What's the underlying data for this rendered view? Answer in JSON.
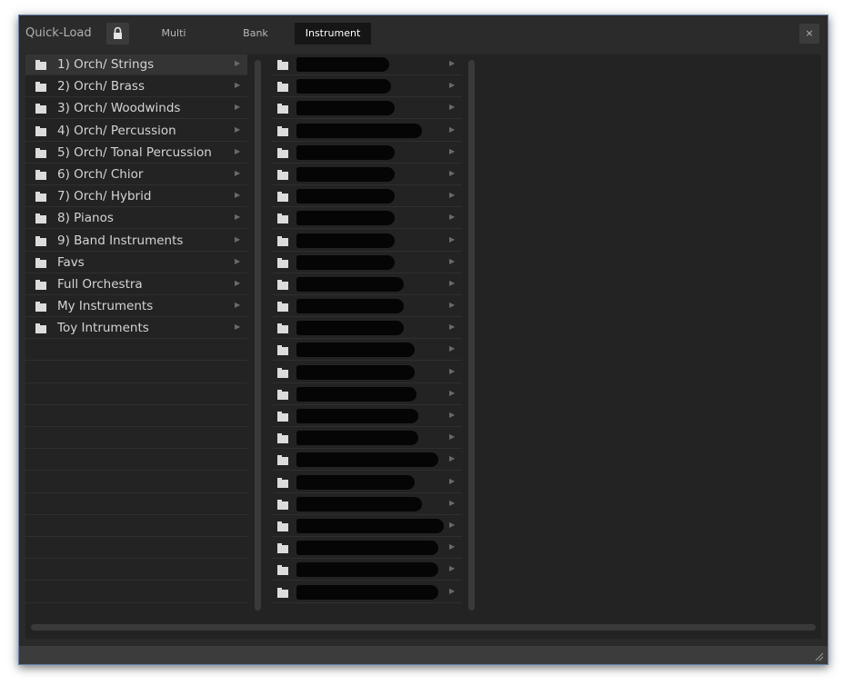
{
  "window": {
    "title": "Quick-Load",
    "close_label": "×"
  },
  "tabs": [
    {
      "label": "Multi",
      "active": false
    },
    {
      "label": "Bank",
      "active": false
    },
    {
      "label": "Instrument",
      "active": true
    }
  ],
  "categories": [
    {
      "label": "1) Orch/ Strings",
      "selected": true
    },
    {
      "label": "2) Orch/ Brass"
    },
    {
      "label": "3) Orch/ Woodwinds"
    },
    {
      "label": "4) Orch/ Percussion"
    },
    {
      "label": "5) Orch/ Tonal Percussion"
    },
    {
      "label": "6) Orch/ Chior"
    },
    {
      "label": "7) Orch/ Hybrid"
    },
    {
      "label": "8) Pianos"
    },
    {
      "label": "9) Band Instruments"
    },
    {
      "label": "Favs"
    },
    {
      "label": "Full Orchestra"
    },
    {
      "label": "My Instruments"
    },
    {
      "label": "Toy Intruments"
    }
  ],
  "subfolder_count_redacted": 25,
  "colors": {
    "background": "#2a2a2a",
    "panel": "#232323",
    "text": "#d4d4d4",
    "active_tab": "#161616",
    "window_border": "#5d7da6"
  },
  "icons": {
    "lock": "lock-icon",
    "close": "close-icon",
    "folder": "folder-icon",
    "chevron": "chevron-right-icon",
    "resize": "resize-grip-icon"
  }
}
